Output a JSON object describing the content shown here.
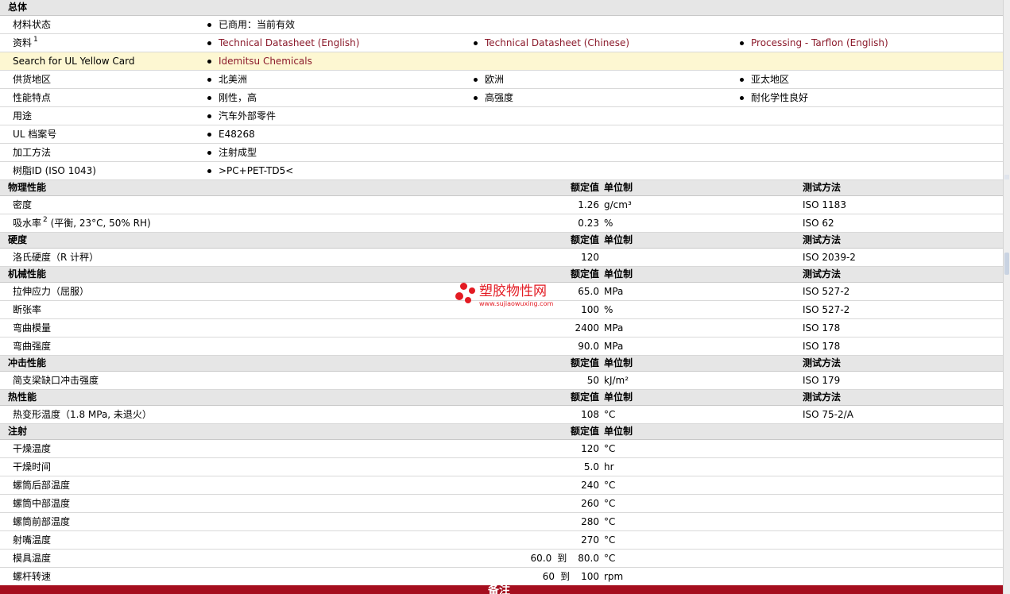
{
  "general": {
    "section_title": "总体",
    "rows": [
      {
        "label": "材料状态",
        "items": [
          {
            "text": "已商用：当前有效"
          }
        ]
      },
      {
        "label": "资料",
        "sup": "1",
        "items": [
          {
            "text": "Technical Datasheet (English)",
            "link": true
          },
          {
            "text": "Technical Datasheet (Chinese)",
            "link": true
          },
          {
            "text": "Processing - Tarflon (English)",
            "link": true
          }
        ]
      },
      {
        "label": "Search for UL Yellow Card",
        "highlight": true,
        "items": [
          {
            "text": "Idemitsu Chemicals",
            "link": true
          }
        ]
      },
      {
        "label": "供货地区",
        "items": [
          {
            "text": "北美洲"
          },
          {
            "text": "欧洲"
          },
          {
            "text": "亚太地区"
          }
        ]
      },
      {
        "label": "性能特点",
        "items": [
          {
            "text": "刚性，高"
          },
          {
            "text": "高强度"
          },
          {
            "text": "耐化学性良好"
          }
        ]
      },
      {
        "label": "用途",
        "items": [
          {
            "text": "汽车外部零件"
          }
        ]
      },
      {
        "label": "UL 档案号",
        "items": [
          {
            "text": "E48268"
          }
        ]
      },
      {
        "label": "加工方法",
        "items": [
          {
            "text": "注射成型"
          }
        ]
      },
      {
        "label": "树脂ID (ISO 1043)",
        "items": [
          {
            "text": ">PC+PET-TD5<"
          }
        ]
      }
    ]
  },
  "sections": [
    {
      "title": "物理性能",
      "value_header": "额定值",
      "unit_header": "单位制",
      "test_header": "测试方法",
      "rows": [
        {
          "label": "密度",
          "value": "1.26",
          "unit": "g/cm³",
          "test": "ISO 1183"
        },
        {
          "label": "吸水率",
          "sup": "2",
          "label_suffix": " (平衡, 23°C, 50% RH)",
          "value": "0.23",
          "unit": "%",
          "test": "ISO 62"
        }
      ]
    },
    {
      "title": "硬度",
      "value_header": "额定值",
      "unit_header": "单位制",
      "test_header": "测试方法",
      "rows": [
        {
          "label": "洛氏硬度（R 计秤）",
          "value": "120",
          "unit": "",
          "test": "ISO 2039-2"
        }
      ]
    },
    {
      "title": "机械性能",
      "value_header": "额定值",
      "unit_header": "单位制",
      "test_header": "测试方法",
      "rows": [
        {
          "label": "拉伸应力（屈服）",
          "value": "65.0",
          "unit": "MPa",
          "test": "ISO 527-2"
        },
        {
          "label": "断张率",
          "value": "100",
          "unit": "%",
          "test": "ISO 527-2"
        },
        {
          "label": "弯曲模量",
          "value": "2400",
          "unit": "MPa",
          "test": "ISO 178"
        },
        {
          "label": "弯曲强度",
          "value": "90.0",
          "unit": "MPa",
          "test": "ISO 178"
        }
      ]
    },
    {
      "title": "冲击性能",
      "value_header": "额定值",
      "unit_header": "单位制",
      "test_header": "测试方法",
      "rows": [
        {
          "label": "简支梁缺口冲击强度",
          "value": "50",
          "unit": "kJ/m²",
          "test": "ISO 179"
        }
      ]
    },
    {
      "title": "热性能",
      "value_header": "额定值",
      "unit_header": "单位制",
      "test_header": "测试方法",
      "rows": [
        {
          "label": "热变形温度（1.8 MPa, 未退火）",
          "value": "108",
          "unit": "°C",
          "test": "ISO 75-2/A"
        }
      ]
    },
    {
      "title": "注射",
      "value_header": "额定值",
      "unit_header": "单位制",
      "test_header": "",
      "rows": [
        {
          "label": "干燥温度",
          "value": "120",
          "unit": "°C",
          "test": ""
        },
        {
          "label": "干燥时间",
          "value": "5.0",
          "unit": "hr",
          "test": ""
        },
        {
          "label": "螺筒后部温度",
          "value": "240",
          "unit": "°C",
          "test": ""
        },
        {
          "label": "螺筒中部温度",
          "value": "260",
          "unit": "°C",
          "test": ""
        },
        {
          "label": "螺筒前部温度",
          "value": "280",
          "unit": "°C",
          "test": ""
        },
        {
          "label": "射嘴温度",
          "value": "270",
          "unit": "°C",
          "test": ""
        },
        {
          "label": "模具温度",
          "value_from": "60.0",
          "value_sep": "到",
          "value": "80.0",
          "unit": "°C",
          "test": ""
        },
        {
          "label": "螺杆转速",
          "value_from": "60",
          "value_sep": "到",
          "value": "100",
          "unit": "rpm",
          "test": ""
        }
      ]
    }
  ],
  "watermark": {
    "title": "塑胶物性网",
    "subtitle": "www.sujiaowuxing.com"
  },
  "footer": {
    "label": "备注"
  },
  "colors": {
    "link": "#8b1a2b",
    "section_bg": "#e6e6e6",
    "highlight_bg": "#fdf7d2",
    "footer_bg": "#a50e1e",
    "watermark": "#e31b23"
  }
}
